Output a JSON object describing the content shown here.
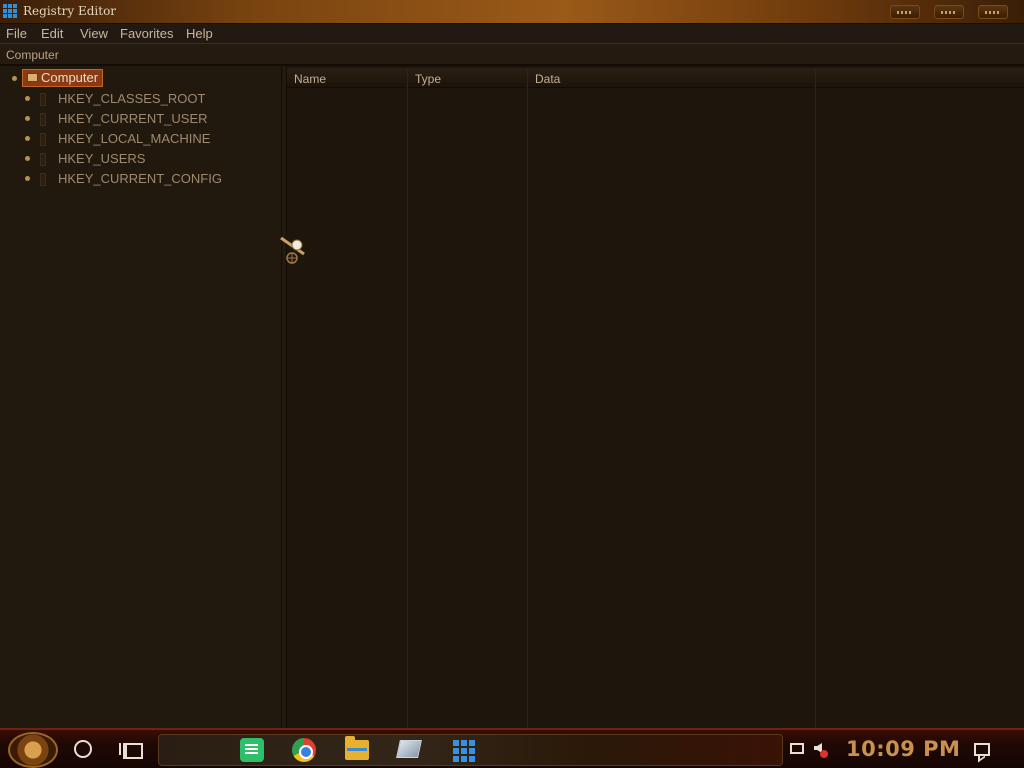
{
  "window": {
    "title": "Registry Editor",
    "icon": "regedit-icon"
  },
  "menu": {
    "items": [
      "File",
      "Edit",
      "View",
      "Favorites",
      "Help"
    ]
  },
  "address": {
    "path": "Computer"
  },
  "tree": {
    "root": "Computer",
    "children": [
      "HKEY_CLASSES_ROOT",
      "HKEY_CURRENT_USER",
      "HKEY_LOCAL_MACHINE",
      "HKEY_USERS",
      "HKEY_CURRENT_CONFIG"
    ]
  },
  "list": {
    "columns": [
      "Name",
      "Type",
      "Data"
    ]
  },
  "taskbar": {
    "pinned": [
      "notes-icon",
      "chrome-icon",
      "file-explorer-icon",
      "tablet-icon",
      "regedit-icon"
    ],
    "clock": "10:09 PM"
  },
  "colors": {
    "accent": "#c8924e",
    "selection": "#8a3a14",
    "background": "#1c140d"
  }
}
